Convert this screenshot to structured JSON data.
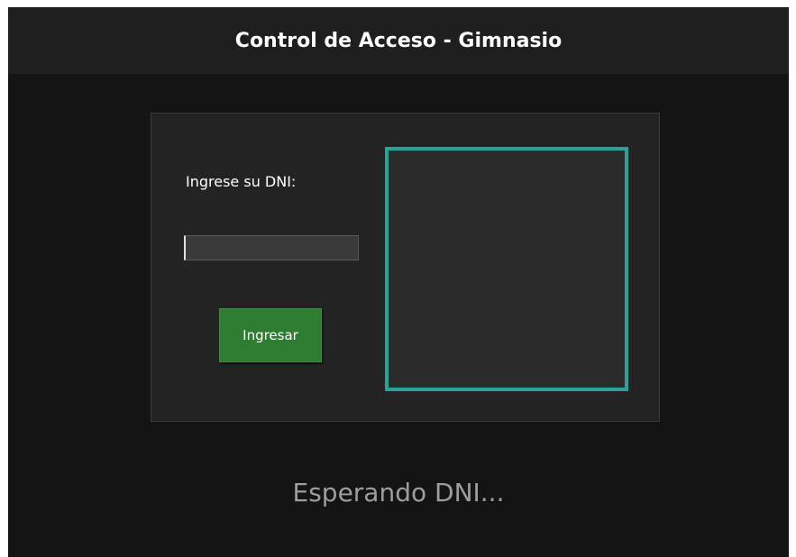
{
  "header": {
    "title": "Control de Acceso - Gimnasio"
  },
  "form": {
    "dni_label": "Ingrese su DNI:",
    "dni_value": "",
    "submit_label": "Ingresar"
  },
  "status": {
    "message": "Esperando DNI..."
  },
  "colors": {
    "background": "#141414",
    "header_background": "#1f1f1f",
    "panel_background": "#232323",
    "button_accent": "#2e7d32",
    "frame_accent": "#26a69a",
    "status_text": "#9e9e9e"
  }
}
